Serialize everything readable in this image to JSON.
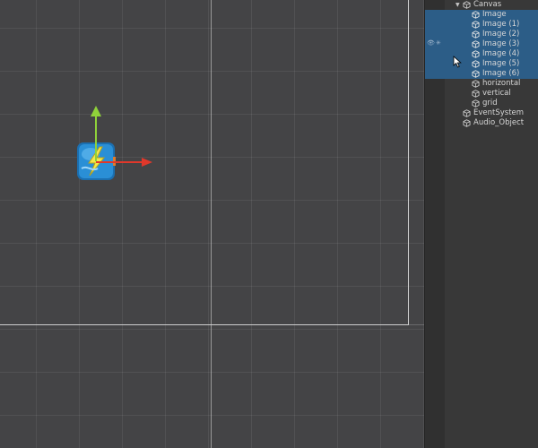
{
  "scene": {
    "gizmo_colors": {
      "x_axis": "#e0382b",
      "y_axis": "#8fd13a"
    },
    "sprite_icon": "lightning-sprite-icon"
  },
  "hierarchy": {
    "selection_color": "#2c5d87",
    "items": [
      {
        "label": "Canvas",
        "expanded": true,
        "selected": false
      },
      {
        "label": "Image",
        "selected": true
      },
      {
        "label": "Image (1)",
        "selected": true
      },
      {
        "label": "Image (2)",
        "selected": true
      },
      {
        "label": "Image (3)",
        "selected": true
      },
      {
        "label": "Image (4)",
        "selected": true
      },
      {
        "label": "Image (5)",
        "selected": true
      },
      {
        "label": "Image (6)",
        "selected": true
      },
      {
        "label": "horizontal",
        "selected": false
      },
      {
        "label": "vertical",
        "selected": false
      },
      {
        "label": "grid",
        "selected": false
      },
      {
        "label": "EventSystem",
        "selected": false
      },
      {
        "label": "Audio_Object",
        "selected": false
      }
    ]
  }
}
